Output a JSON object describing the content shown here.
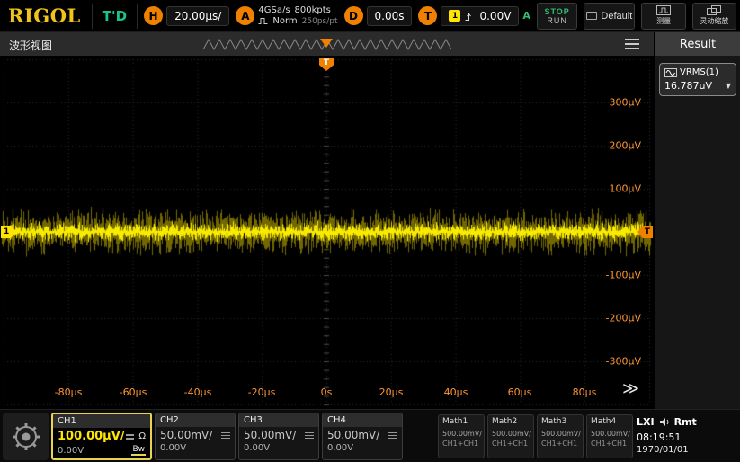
{
  "brand": "RIGOL",
  "topbar": {
    "trigger_status": "T'D",
    "horizontal": {
      "letter": "H",
      "timebase": "20.00μs/"
    },
    "acquisition": {
      "letter": "A",
      "sample_rate": "4GSa/s",
      "memory_depth": "800kpts",
      "mode": "Norm",
      "resolution": "250ps/pt"
    },
    "delay": {
      "letter": "D",
      "value": "0.00s"
    },
    "trigger": {
      "letter": "T",
      "source": "1",
      "level": "0.00V",
      "sweep": "A"
    },
    "stop_run_button": {
      "stop": "STOP",
      "run": "RUN"
    },
    "default_button": "Default",
    "measure_button": "测量",
    "zoom_button": "灵动缩放"
  },
  "navbar": {
    "view_label": "波形视图"
  },
  "result_panel": {
    "title": "Result",
    "items": [
      {
        "label": "VRMS(1)",
        "value": "16.787uV"
      }
    ]
  },
  "scope": {
    "v_labels": [
      "300μV",
      "200μV",
      "100μV",
      "-100μV",
      "-200μV",
      "-300μV"
    ],
    "t_labels": [
      "-80μs",
      "-60μs",
      "-40μs",
      "-20μs",
      "0s",
      "20μs",
      "40μs",
      "60μs",
      "80μs"
    ],
    "trigger_marker": "T",
    "channel_marker": "1"
  },
  "waveform": {
    "color": "#ffee00",
    "center_volts": "0.00V",
    "noise_rms_uV": 16.787,
    "volts_per_div_uV": 100,
    "time_per_div": "20.00μs"
  },
  "bottombar": {
    "channels": [
      {
        "name": "CH1",
        "scale": "100.00μV/",
        "offset": "0.00V",
        "bw": "Bw",
        "impedance": "Ω",
        "active": true
      },
      {
        "name": "CH2",
        "scale": "50.00mV/",
        "offset": "0.00V",
        "active": false
      },
      {
        "name": "CH3",
        "scale": "50.00mV/",
        "offset": "0.00V",
        "active": false
      },
      {
        "name": "CH4",
        "scale": "50.00mV/",
        "offset": "0.00V",
        "active": false
      }
    ],
    "maths": [
      {
        "name": "Math1",
        "scale": "500.00mV/",
        "expr": "CH1+CH1"
      },
      {
        "name": "Math2",
        "scale": "500.00mV/",
        "expr": "CH1+CH1"
      },
      {
        "name": "Math3",
        "scale": "500.00mV/",
        "expr": "CH1+CH1"
      },
      {
        "name": "Math4",
        "scale": "500.00mV/",
        "expr": "CH1+CH1"
      }
    ],
    "status": {
      "lxi": "LXI",
      "rmt": "Rmt",
      "time": "08:19:51",
      "date": "1970/01/01"
    }
  }
}
